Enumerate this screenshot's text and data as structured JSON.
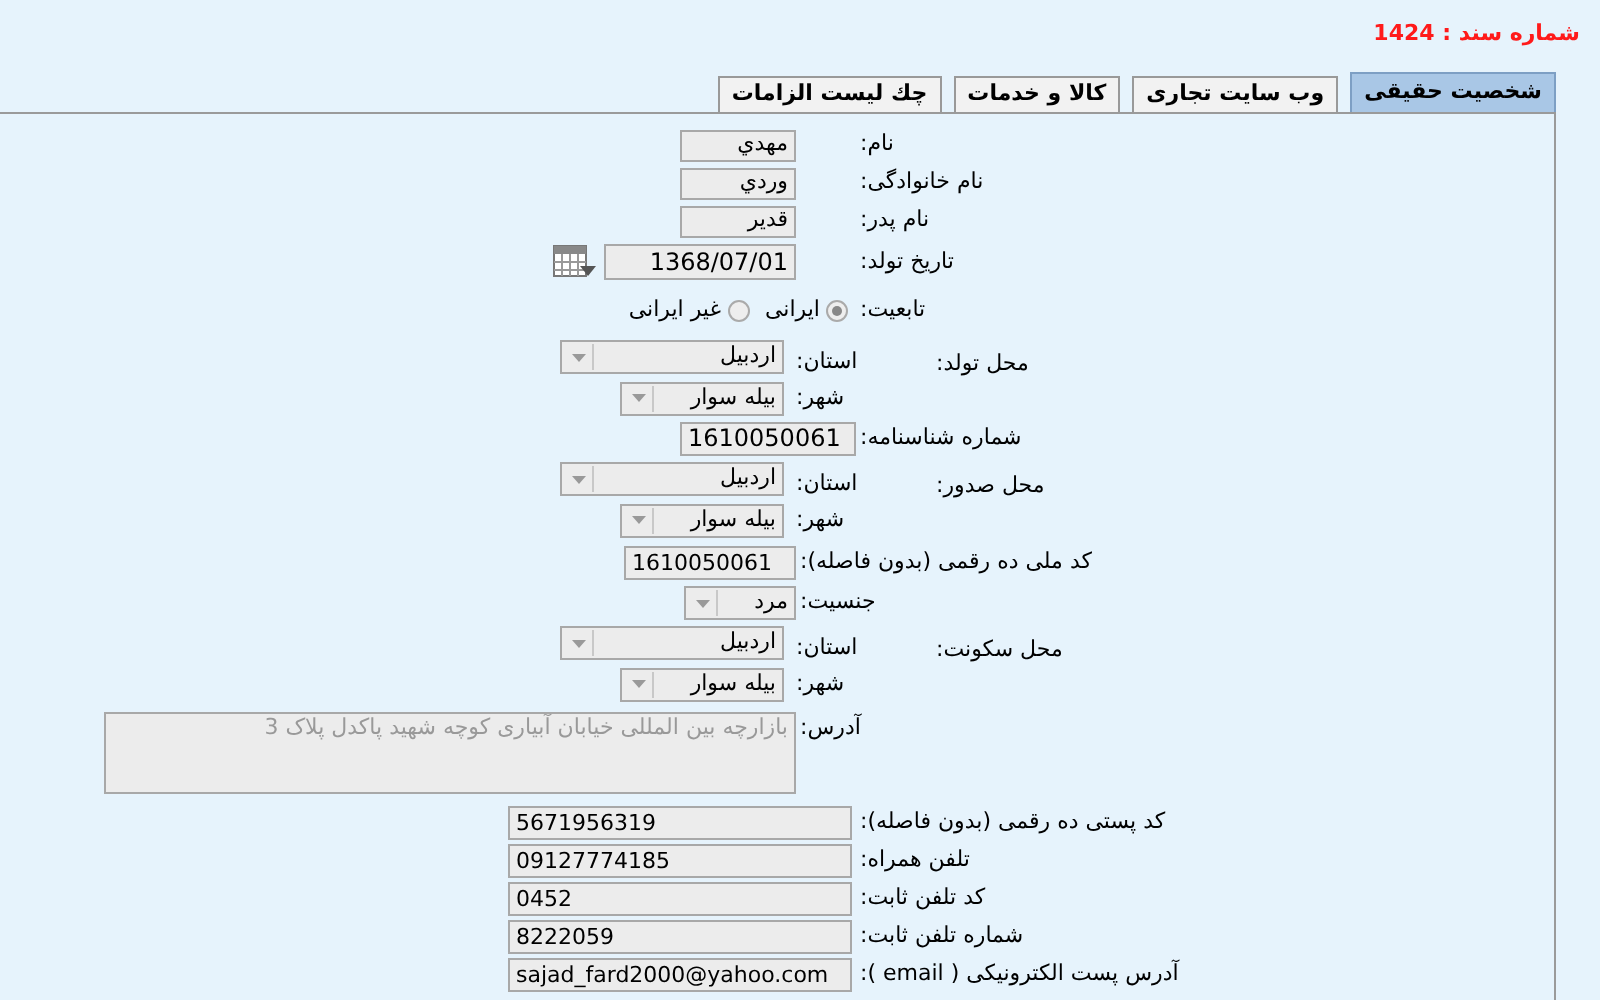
{
  "document_number": "شماره سند : 1424",
  "tabs": [
    {
      "label": "شخصیت حقیقی",
      "selected": true
    },
    {
      "label": "وب سایت تجاری",
      "selected": false
    },
    {
      "label": "کالا و خدمات",
      "selected": false
    },
    {
      "label": "چك ليست الزامات",
      "selected": false
    }
  ],
  "form": [
    {
      "kind": "text",
      "label": "نام:",
      "value": "مهدي"
    },
    {
      "kind": "text",
      "label": "نام خانوادگی:",
      "value": "وردي"
    },
    {
      "kind": "text",
      "label": "نام پدر:",
      "value": "قدير"
    },
    {
      "kind": "date",
      "label": "تاریخ تولد:",
      "value": "1368/07/01"
    },
    {
      "kind": "radio",
      "label": "تابعیت:",
      "options": [
        {
          "label": "ایرانی",
          "selected": true
        },
        {
          "label": "غیر ایرانی",
          "selected": false
        }
      ]
    },
    {
      "kind": "place",
      "label": "محل تولد:",
      "province": {
        "label": "استان:",
        "value": "اردبیل"
      },
      "city": {
        "label": "شهر:",
        "value": "بیله سوار"
      }
    },
    {
      "kind": "number",
      "label": "شماره شناسنامه:",
      "value": "1610050061"
    },
    {
      "kind": "place",
      "label": "محل صدور:",
      "province": {
        "label": "استان:",
        "value": "اردبیل"
      },
      "city": {
        "label": "شهر:",
        "value": "بیله سوار"
      }
    },
    {
      "kind": "id",
      "label": "کد ملی ده رقمی (بدون فاصله):",
      "value": "1610050061"
    },
    {
      "kind": "select",
      "label": "جنسیت:",
      "value": "مرد"
    },
    {
      "kind": "place",
      "label": "محل سکونت:",
      "province": {
        "label": "استان:",
        "value": "اردبیل"
      },
      "city": {
        "label": "شهر:",
        "value": "بیله سوار"
      }
    },
    {
      "kind": "address",
      "label": "آدرس:",
      "placeholder": "بازارچه بین المللی خیابان آبیاری کوچه شهید پاکدل پلاک 3"
    },
    {
      "kind": "contact",
      "label": "کد پستی ده رقمی (بدون فاصله):",
      "value": "5671956319"
    },
    {
      "kind": "contact",
      "label": "تلفن همراه:",
      "value": "09127774185"
    },
    {
      "kind": "contact",
      "label": "کد تلفن ثابت:",
      "value": "0452"
    },
    {
      "kind": "contact",
      "label": "شماره تلفن ثابت:",
      "value": "8222059"
    },
    {
      "kind": "contact",
      "label": "آدرس پست الکترونیکی ( email ):",
      "value": "sajad_fard2000@yahoo.com"
    }
  ]
}
